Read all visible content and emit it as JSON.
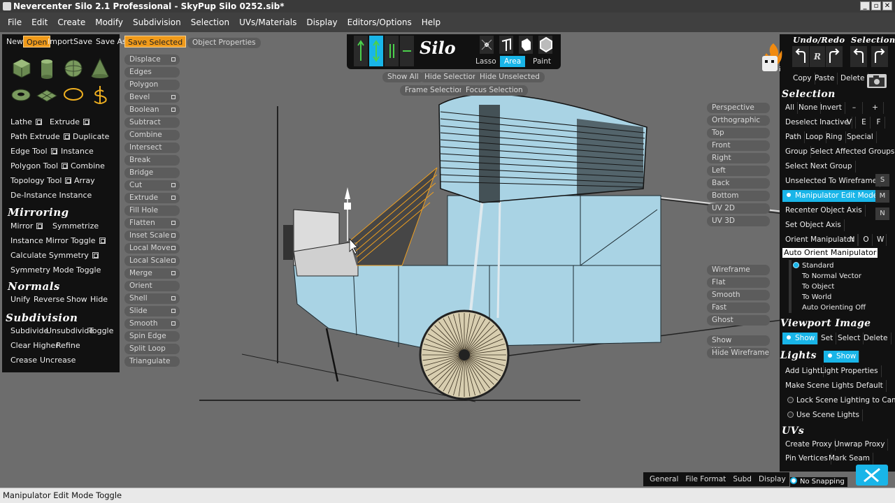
{
  "window": {
    "title": "Nevercenter Silo 2.1 Professional - SkyPup Silo 0252.sib*"
  },
  "menu": [
    "File",
    "Edit",
    "Create",
    "Modify",
    "Subdivision",
    "Selection",
    "UVs/Materials",
    "Display",
    "Editors/Options",
    "Help"
  ],
  "file_toolbar": [
    "New",
    "Open",
    "Import",
    "Save",
    "Save As",
    "Save Selected"
  ],
  "object_properties": "Object Properties",
  "left_tools": {
    "lathe": "Lathe",
    "extrude": "Extrude",
    "path_extrude": "Path Extrude",
    "duplicate": "Duplicate",
    "edge_tool": "Edge Tool",
    "instance": "Instance",
    "polygon_tool": "Polygon Tool",
    "combine": "Combine",
    "topology_tool": "Topology Tool",
    "array": "Array",
    "de_instance": "De-Instance Instance"
  },
  "mirroring": {
    "title": "Mirroring",
    "mirror": "Mirror",
    "symmetrize": "Symmetrize",
    "instance_mirror_toggle": "Instance Mirror Toggle",
    "calculate_symmetry": "Calculate Symmetry",
    "symmetry_mode_toggle": "Symmetry Mode Toggle"
  },
  "normals": {
    "title": "Normals",
    "unify": "Unify",
    "reverse": "Reverse",
    "show": "Show",
    "hide": "Hide"
  },
  "subdivision": {
    "title": "Subdivision",
    "subdivide": "Subdivide",
    "unsubdivide": "Unsubdivide",
    "toggle": "Toggle",
    "clear_higher": "Clear Higher",
    "refine": "Refine",
    "crease": "Crease",
    "uncrease": "Uncrease"
  },
  "modify_tools": [
    "Displace",
    "Edges",
    "Polygon",
    "Bevel",
    "Boolean",
    "Subtract",
    "Combine",
    "Intersect",
    "Break",
    "Bridge",
    "Cut",
    "Extrude",
    "Fill Hole",
    "Flatten",
    "Inset Scale",
    "Local Move",
    "Local Scale",
    "Merge",
    "Orient",
    "Shell",
    "Slide",
    "Smooth",
    "Spin Edge",
    "Split Loop",
    "Triangulate"
  ],
  "top_toolbar": {
    "logo": "Silo",
    "lasso": "Lasso",
    "area": "Area",
    "paint": "Paint"
  },
  "selection_view": {
    "show_all": "Show All",
    "hide_selection": "Hide Selection",
    "hide_unselected": "Hide Unselected",
    "frame_selection": "Frame Selection",
    "focus_selection": "Focus Selection"
  },
  "view_modes": [
    "Perspective",
    "Orthographic",
    "Top",
    "Front",
    "Right",
    "Left",
    "Back",
    "Bottom",
    "UV 2D",
    "UV 3D"
  ],
  "shading_modes": [
    "Wireframe",
    "Flat",
    "Smooth",
    "Fast",
    "Ghost"
  ],
  "wireframe_toggle": {
    "show": "Show Wireframe",
    "hide": "Hide Wireframe"
  },
  "right_panel": {
    "undo_redo_title": "Undo/Redo",
    "selection_title": "Selection",
    "copy": "Copy",
    "paste": "Paste",
    "delete": "Delete",
    "selection": {
      "title": "Selection",
      "all": "All",
      "none": "None",
      "invert": "Invert",
      "minus": "–",
      "plus": "+",
      "deselect_inactive": "Deselect Inactive",
      "v": "V",
      "e": "E",
      "f": "F",
      "path": "Path",
      "loop": "Loop",
      "ring": "Ring",
      "special": "Special",
      "group": "Group",
      "select_affected_groups": "Select Affected Groups",
      "select_next_group": "Select Next Group",
      "unselected_to_wireframe": "Unselected To Wireframe",
      "s": "S",
      "manipulator_edit_mode": "Manipulator Edit Mode",
      "m": "M",
      "recenter_object_axis": "Recenter Object Axis",
      "n_side": "N",
      "set_object_axis": "Set Object Axis",
      "orient_manipulator": "Orient Manipulator",
      "n": "N",
      "o": "O",
      "w": "W",
      "auto_orient_manipulator": "Auto Orient Manipulator",
      "orient_options": [
        "Standard",
        "To Normal Vector",
        "To Object",
        "To World",
        "Auto Orienting Off"
      ]
    },
    "viewport_image": {
      "title": "Viewport Image",
      "show": "Show",
      "set": "Set",
      "select": "Select",
      "delete": "Delete"
    },
    "lights": {
      "title": "Lights",
      "show": "Show",
      "add_light": "Add Light",
      "light_properties": "Light Properties",
      "make_default": "Make Scene Lights Default",
      "lock_to_cam": "Lock Scene Lighting to Cam",
      "use_scene_lights": "Use Scene Lights"
    },
    "uvs": {
      "title": "UVs",
      "create_proxy": "Create Proxy",
      "unwrap_proxy": "Unwrap Proxy",
      "pin_vertices": "Pin Vertices",
      "mark_seam": "Mark Seam"
    }
  },
  "bottom_tabs": [
    "General",
    "File Format",
    "Subd",
    "Display"
  ],
  "no_snapping": "No Snapping",
  "status_bar": "Manipulator Edit Mode Toggle",
  "colors": {
    "accent": "#19b5e8",
    "highlight": "#f09a1a",
    "panel": "#111111",
    "viewport": "#6d6d6d",
    "model": "#a9d3e4",
    "selected_edges": "#f0a020"
  }
}
